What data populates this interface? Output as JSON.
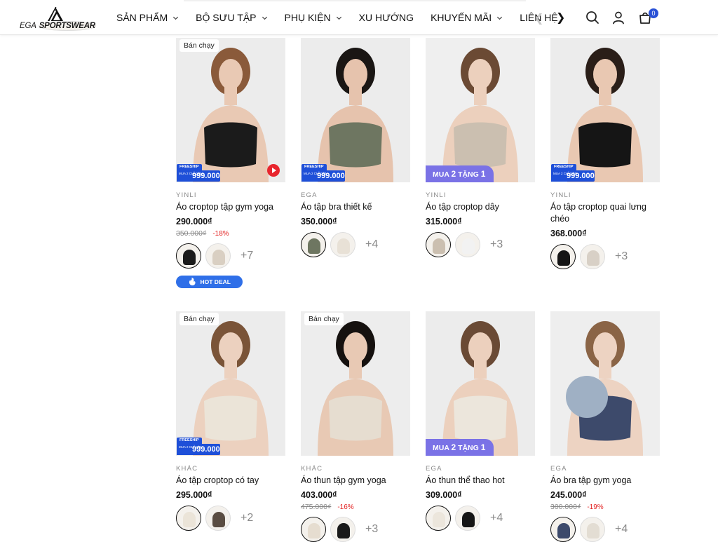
{
  "header": {
    "logo_prefix": "EGA",
    "logo_name": "SPORTSWEAR",
    "nav": [
      {
        "label": "SẢN PHẨM",
        "dropdown": true
      },
      {
        "label": "BỘ SƯU TẬP",
        "dropdown": true
      },
      {
        "label": "PHỤ KIỆN",
        "dropdown": true
      },
      {
        "label": "XU HƯỚNG",
        "dropdown": false
      },
      {
        "label": "KHUYẾN MÃI",
        "dropdown": true
      },
      {
        "label": "LIÊN HỆ",
        "dropdown": false
      }
    ],
    "cart_count": "0",
    "icons": [
      "search-icon",
      "user-icon",
      "cart-icon"
    ]
  },
  "labels": {
    "best_seller": "Bán chạy",
    "freeship": "FREESHIP",
    "freeship_mua": "MUA 2 CHỈ CÒN",
    "freeship_price": "999.000",
    "promo_pre": "MUA",
    "promo_mid": "2",
    "promo_post": "TẶNG",
    "promo_num": "1",
    "hot_deal": "HOT DEAL"
  },
  "colors": {
    "accent": "#2951d6",
    "discount": "#e32424",
    "promo": "#7a72e6"
  },
  "products": [
    {
      "brand": "YINLI",
      "name": "Áo croptop tập gym yoga",
      "price": "290.000₫",
      "old_price": "350.000₫",
      "discount": "-18%",
      "more": "+7",
      "best": true,
      "ribbon": "freeship",
      "video": true,
      "hot": true,
      "bg": "#ececec",
      "top": "#1b1b1b",
      "skin": "#e9c9b4",
      "hair": "#8a5a3a",
      "sw": [
        "#1b1b1b",
        "#d9cfc2"
      ]
    },
    {
      "brand": "EGA",
      "name": "Áo tập bra thiết kế",
      "price": "350.000₫",
      "more": "+4",
      "ribbon": "freeship",
      "bg": "#ececec",
      "top": "#6e7661",
      "skin": "#e6c3ad",
      "hair": "#1a1614",
      "sw": [
        "#6e7661",
        "#e8e1d6"
      ]
    },
    {
      "brand": "YINLI",
      "name": "Áo tập croptop dây",
      "price": "315.000₫",
      "more": "+3",
      "ribbon": "promo",
      "bg": "#efefef",
      "top": "#cbbfb0",
      "skin": "#ecd0bd",
      "hair": "#6b4a34",
      "sw": [
        "#cbbfb0",
        "#f2f2f2"
      ]
    },
    {
      "brand": "YINLI",
      "name": "Áo tập croptop quai lưng chéo",
      "price": "368.000₫",
      "more": "+3",
      "ribbon": "freeship",
      "bg": "#ececec",
      "top": "#151515",
      "skin": "#e9c8b2",
      "hair": "#2a1e18",
      "sw": [
        "#151515",
        "#d8d0c6"
      ]
    },
    {
      "brand": "KHÁC",
      "name": "Áo tập croptop có tay",
      "price": "295.000₫",
      "more": "+2",
      "best": true,
      "ribbon": "freeship",
      "bg": "#ececec",
      "top": "#ebe4d8",
      "skin": "#ecd1bf",
      "hair": "#7a5438",
      "sw": [
        "#ebe4d8",
        "#5a4d42"
      ]
    },
    {
      "brand": "KHÁC",
      "name": "Áo thun tập gym yoga",
      "price": "403.000₫",
      "old_price": "475.000₫",
      "discount": "-16%",
      "more": "+3",
      "best": true,
      "ribbon": "none",
      "bg": "#ededed",
      "top": "#e6ddd0",
      "skin": "#e8c9b4",
      "hair": "#15110f",
      "sw": [
        "#e6ddd0",
        "#1a1a1a"
      ]
    },
    {
      "brand": "EGA",
      "name": "Áo thun thể thao hot",
      "price": "309.000₫",
      "more": "+4",
      "ribbon": "promo",
      "bg": "#ececec",
      "top": "#ece6dc",
      "skin": "#ecd0bd",
      "hair": "#6a4a35",
      "sw": [
        "#ece6dc",
        "#161616"
      ]
    },
    {
      "brand": "EGA",
      "name": "Áo bra tập gym yoga",
      "price": "245.000₫",
      "old_price": "300.000₫",
      "discount": "-19%",
      "more": "+4",
      "ribbon": "none",
      "ball": true,
      "bg": "#eeeeee",
      "top": "#3d4a6b",
      "skin": "#edd3c2",
      "hair": "#8a6446",
      "sw": [
        "#3d4a6b",
        "#e3ddd3"
      ]
    }
  ]
}
